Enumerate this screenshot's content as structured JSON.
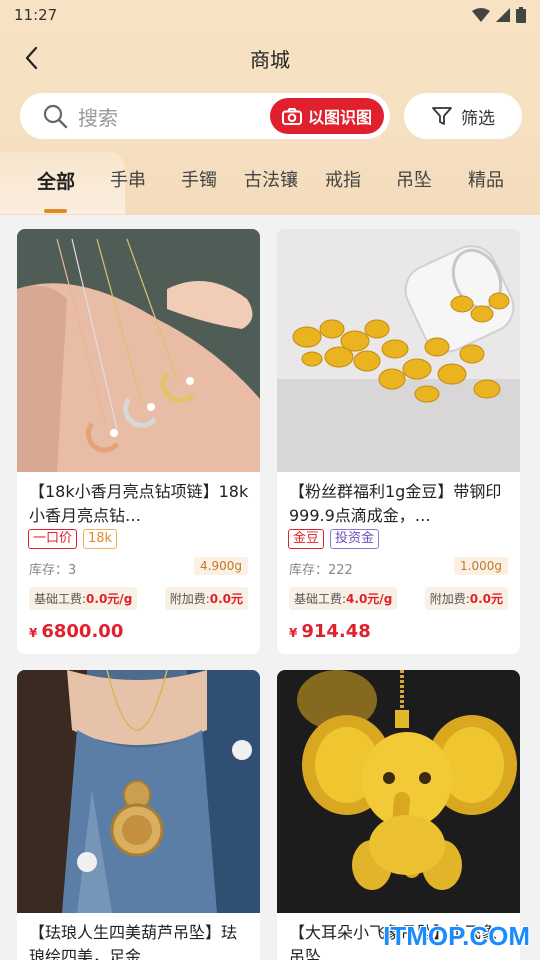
{
  "status_bar": {
    "time": "11:27"
  },
  "header": {
    "title": "商城"
  },
  "search": {
    "placeholder": "搜索",
    "image_search_label": "以图识图",
    "filter_label": "筛选"
  },
  "tabs": [
    {
      "label": "全部",
      "active": true
    },
    {
      "label": "手串"
    },
    {
      "label": "手镯"
    },
    {
      "label": "古法镶"
    },
    {
      "label": "戒指"
    },
    {
      "label": "吊坠"
    },
    {
      "label": "精品"
    }
  ],
  "products": [
    {
      "title": "【18k小香月亮点钻项链】18k小香月亮点钻…",
      "tags": [
        {
          "text": "一口价",
          "style": "red"
        },
        {
          "text": "18k",
          "style": "orange"
        }
      ],
      "stock": "库存：3",
      "weight": "4.900g",
      "base_fee_label": "基础工费:",
      "base_fee": "0.0元/g",
      "extra_fee_label": "附加费:",
      "extra_fee": "0.0元",
      "currency": "¥",
      "price": "6800.00",
      "image": "moon-diamond-necklaces"
    },
    {
      "title": "【粉丝群福利1g金豆】带钢印999.9点滴成金，…",
      "tags": [
        {
          "text": "金豆",
          "style": "red"
        },
        {
          "text": "投资金",
          "style": "purple"
        }
      ],
      "stock": "库存：222",
      "weight": "1.000g",
      "base_fee_label": "基础工费:",
      "base_fee": "4.0元/g",
      "extra_fee_label": "附加费:",
      "extra_fee": "0.0元",
      "currency": "¥",
      "price": "914.48",
      "image": "gold-beans-jar"
    },
    {
      "title": "【珐琅人生四美葫芦吊坠】珐琅绘四美，足金…",
      "image": "enamel-gourd-pendant"
    },
    {
      "title": "【大耳朵小飞象吊坠】小飞象吊坠",
      "image": "gold-elephant-pendant"
    }
  ],
  "watermark": "ITMOP.COM",
  "colors": {
    "accent": "#e0202c",
    "tab_indicator": "#e08a2c",
    "header_bg": "#f7e2c4"
  }
}
